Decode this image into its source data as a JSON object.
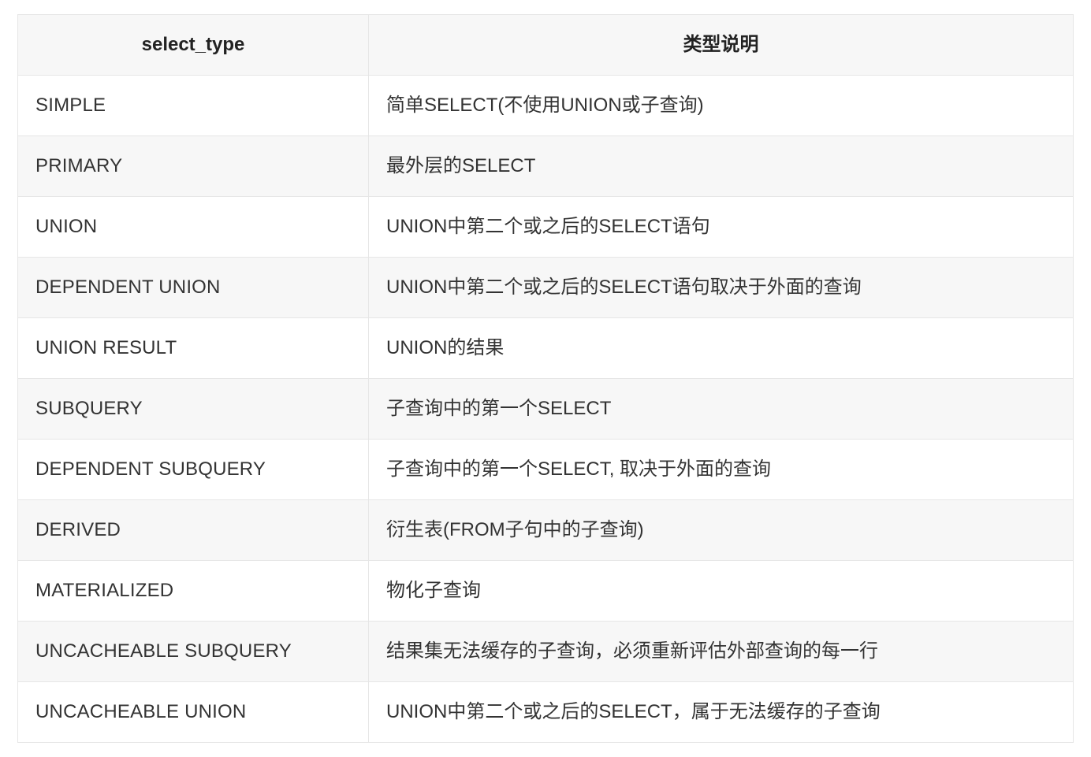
{
  "table": {
    "headers": {
      "col1": "select_type",
      "col2": "类型说明"
    },
    "rows": [
      {
        "type": "SIMPLE",
        "desc": "简单SELECT(不使用UNION或子查询)"
      },
      {
        "type": "PRIMARY",
        "desc": "最外层的SELECT"
      },
      {
        "type": "UNION",
        "desc": "UNION中第二个或之后的SELECT语句"
      },
      {
        "type": "DEPENDENT UNION",
        "desc": "UNION中第二个或之后的SELECT语句取决于外面的查询"
      },
      {
        "type": "UNION RESULT",
        "desc": "UNION的结果"
      },
      {
        "type": "SUBQUERY",
        "desc": "子查询中的第一个SELECT"
      },
      {
        "type": "DEPENDENT SUBQUERY",
        "desc": "子查询中的第一个SELECT, 取决于外面的查询"
      },
      {
        "type": "DERIVED",
        "desc": "衍生表(FROM子句中的子查询)"
      },
      {
        "type": "MATERIALIZED",
        "desc": "物化子查询"
      },
      {
        "type": "UNCACHEABLE SUBQUERY",
        "desc": "结果集无法缓存的子查询，必须重新评估外部查询的每一行"
      },
      {
        "type": "UNCACHEABLE UNION",
        "desc": "UNION中第二个或之后的SELECT，属于无法缓存的子查询"
      }
    ]
  }
}
